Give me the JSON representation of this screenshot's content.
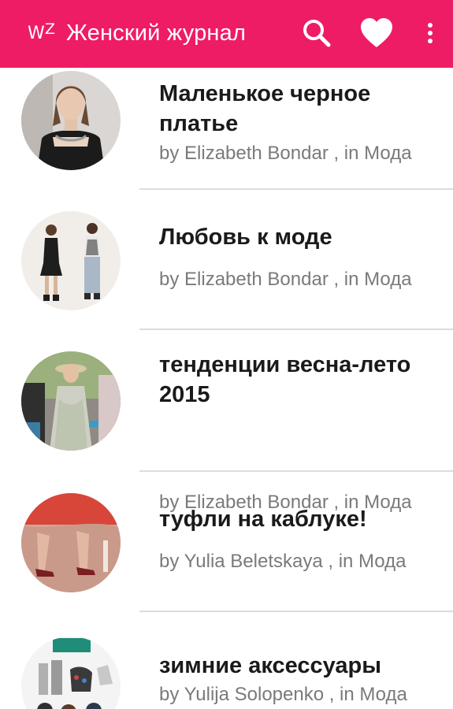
{
  "app_bar": {
    "logo_w": "W",
    "logo_z": "Z",
    "title": "Женский журнал",
    "background": "#ee1c64",
    "actions": [
      "search-icon",
      "heart-icon",
      "more-vert-icon"
    ]
  },
  "articles": [
    {
      "title": "Маленькое черное платье",
      "meta": "by Elizabeth Bondar , in Мода"
    },
    {
      "title": "Любовь к моде",
      "meta": "by Elizabeth Bondar , in Мода"
    },
    {
      "title": "тенденции весна-лето 2015",
      "meta": "by Elizabeth Bondar , in Мода"
    },
    {
      "title": "туфли на каблуке!",
      "meta": "by Yulia Beletskaya , in Мода"
    },
    {
      "title": "зимние аксессуары",
      "meta": "by Yulija Solopenko , in Мода"
    }
  ]
}
